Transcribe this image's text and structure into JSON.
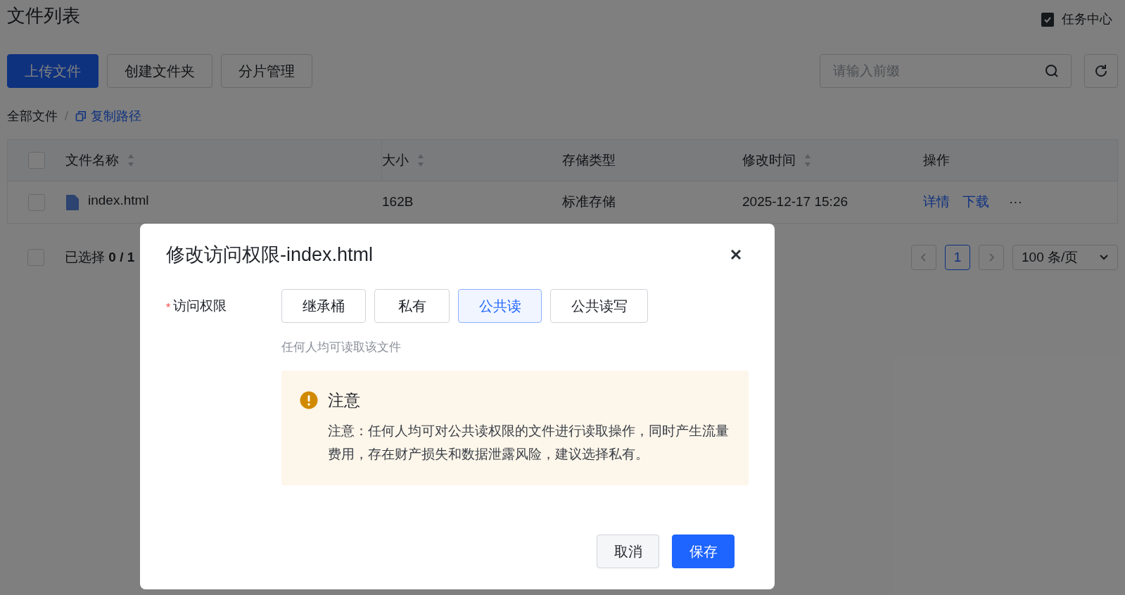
{
  "page_title": "文件列表",
  "task_center": {
    "label": "任务中心",
    "checked": true
  },
  "toolbar": [
    {
      "label": "上传文件",
      "kind": "primary"
    },
    {
      "label": "创建文件夹",
      "kind": "default"
    },
    {
      "label": "分片管理",
      "kind": "default"
    }
  ],
  "search": {
    "placeholder": "请输入前缀"
  },
  "breadcrumb": {
    "root": "全部文件",
    "separator": "/",
    "copy_link": "复制路径"
  },
  "table": {
    "columns": [
      {
        "label": "文件名称",
        "sortable": true
      },
      {
        "label": "大小",
        "sortable": true
      },
      {
        "label": "存储类型",
        "sortable": false
      },
      {
        "label": "修改时间",
        "sortable": true
      },
      {
        "label": "操作",
        "sortable": false
      }
    ],
    "header_checked": false,
    "rows": [
      {
        "selected": false,
        "name": "index.html",
        "size": "162B",
        "storage": "标准存储",
        "modified": "2025-12-17 15:26",
        "actions": [
          "详情",
          "下载"
        ],
        "more": "···"
      }
    ]
  },
  "footer": {
    "checked": false,
    "selected_text": "已选择 **0 / 1**"
  },
  "pagination": {
    "pages": [
      {
        "label": "1",
        "selected": true
      }
    ],
    "page_size": "100 条/页"
  },
  "dialog": {
    "title": "修改访问权限-index.html",
    "field_label": "访问权限",
    "required_mark": "*",
    "options": [
      {
        "label": "继承桶",
        "selected": false
      },
      {
        "label": "私有",
        "selected": false
      },
      {
        "label": "公共读",
        "selected": true
      },
      {
        "label": "公共读写",
        "selected": false
      }
    ],
    "hint": "任何人均可读取该文件",
    "notice": {
      "title": "注意",
      "text": "注意：任何人均可对公共读权限的文件进行读取操作，同时产生流量费用，存在财产损失和数据泄露风险，建议选择私有。"
    },
    "buttons": [
      {
        "label": "取消",
        "kind": "default"
      },
      {
        "label": "保存",
        "kind": "primary"
      }
    ]
  }
}
